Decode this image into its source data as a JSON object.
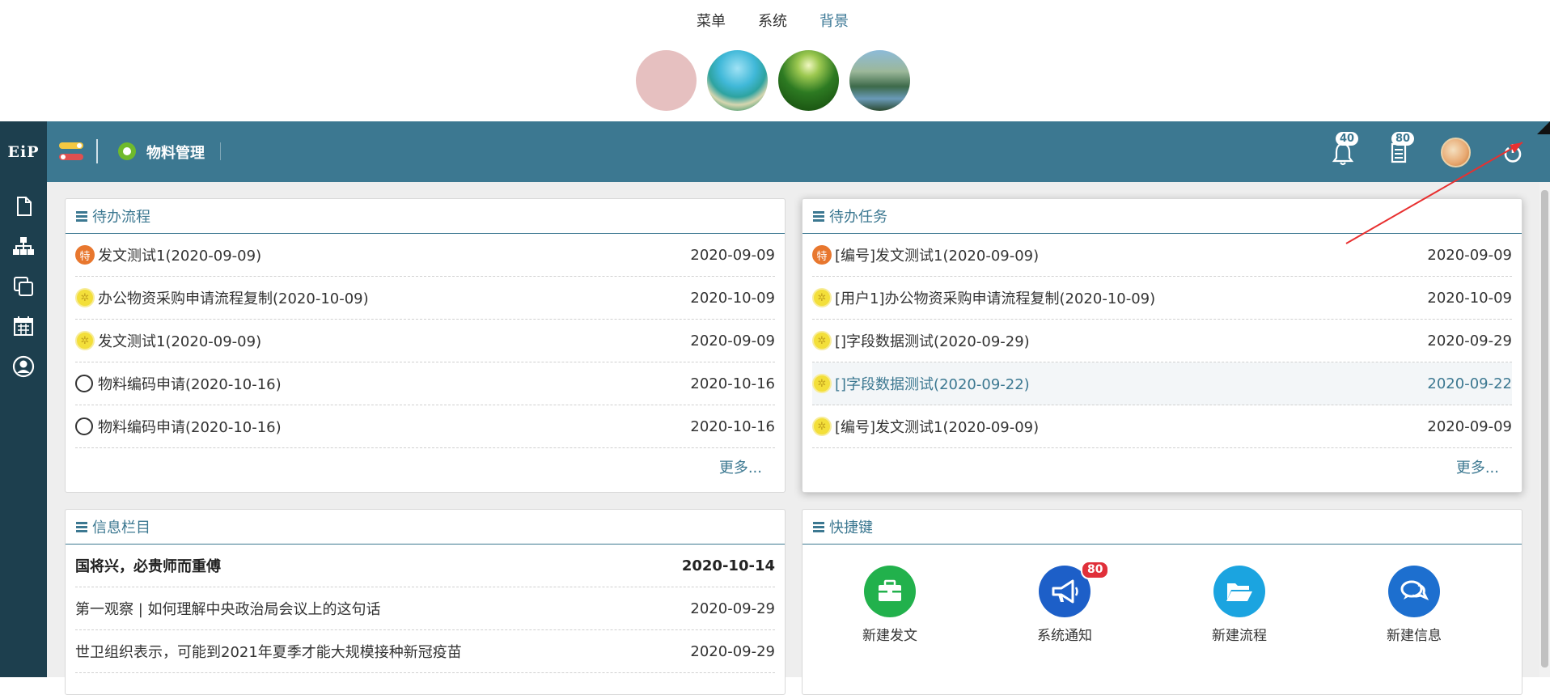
{
  "settings": {
    "menu": [
      {
        "label": "菜单"
      },
      {
        "label": "系统"
      },
      {
        "label": "背景"
      }
    ],
    "active_menu": "背景",
    "backgrounds": [
      "pink",
      "beach",
      "forest",
      "lake"
    ]
  },
  "header": {
    "logo": "EiP",
    "module_title": "物料管理",
    "notifications_count": "40",
    "documents_count": "80"
  },
  "sidebar": {
    "icons": [
      "file-icon",
      "org-chart-icon",
      "copy-icon",
      "calendar-icon",
      "user-icon"
    ]
  },
  "pending_flow": {
    "title": "待办流程",
    "items": [
      {
        "icon": "te",
        "icon_text": "特",
        "text": "发文测试1(2020-09-09)",
        "date": "2020-09-09"
      },
      {
        "icon": "urg",
        "icon_text": "",
        "text": "办公物资采购申请流程复制(2020-10-09)",
        "date": "2020-10-09"
      },
      {
        "icon": "urg",
        "icon_text": "",
        "text": "发文测试1(2020-09-09)",
        "date": "2020-09-09"
      },
      {
        "icon": "circ",
        "icon_text": "",
        "text": "物料编码申请(2020-10-16)",
        "date": "2020-10-16"
      },
      {
        "icon": "circ",
        "icon_text": "",
        "text": "物料编码申请(2020-10-16)",
        "date": "2020-10-16"
      }
    ],
    "more": "更多..."
  },
  "pending_task": {
    "title": "待办任务",
    "items": [
      {
        "icon": "te",
        "icon_text": "特",
        "text": "[编号]发文测试1(2020-09-09)",
        "date": "2020-09-09"
      },
      {
        "icon": "urg",
        "icon_text": "",
        "text": "[用户1]办公物资采购申请流程复制(2020-10-09)",
        "date": "2020-10-09"
      },
      {
        "icon": "urg",
        "icon_text": "",
        "text": "[]字段数据测试(2020-09-29)",
        "date": "2020-09-29"
      },
      {
        "icon": "urg",
        "icon_text": "",
        "text": "[]字段数据测试(2020-09-22)",
        "date": "2020-09-22"
      },
      {
        "icon": "urg",
        "icon_text": "",
        "text": "[编号]发文测试1(2020-09-09)",
        "date": "2020-09-09"
      }
    ],
    "more": "更多..."
  },
  "info_column": {
    "title": "信息栏目",
    "items": [
      {
        "text": "国将兴，必贵师而重傅",
        "date": "2020-10-14"
      },
      {
        "text": "第一观察 | 如何理解中央政治局会议上的这句话",
        "date": "2020-09-29"
      },
      {
        "text": "世卫组织表示，可能到2021年夏季才能大规模接种新冠疫苗",
        "date": "2020-09-29"
      }
    ]
  },
  "shortcuts": {
    "title": "快捷键",
    "items": [
      {
        "label": "新建发文",
        "color": "#22b14c",
        "icon": "briefcase-icon"
      },
      {
        "label": "系统通知",
        "color": "#1d5fc8",
        "icon": "megaphone-icon",
        "badge": "80"
      },
      {
        "label": "新建流程",
        "color": "#1ba4e0",
        "icon": "folder-open-icon"
      },
      {
        "label": "新建信息",
        "color": "#1d6fcf",
        "icon": "chat-icon"
      }
    ]
  },
  "colors": {
    "header_bg": "#3c7891",
    "sidebar_bg": "#1d3f4e",
    "accent": "#3c7891"
  }
}
